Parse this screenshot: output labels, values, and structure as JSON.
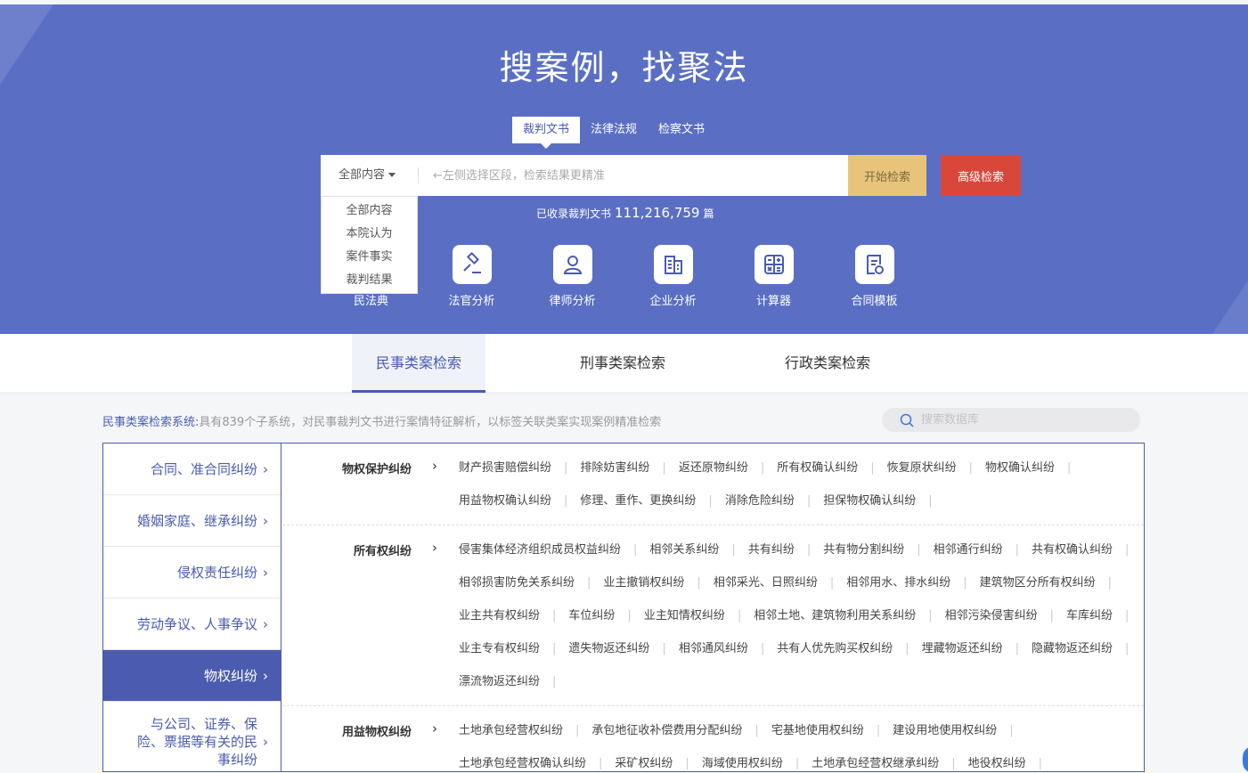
{
  "hero": {
    "title": "搜案例，找聚法",
    "doc_tabs": [
      "裁判文书",
      "法律法规",
      "检察文书"
    ],
    "search": {
      "scope_label": "全部内容",
      "placeholder": "←左侧选择区段，检索结果更精准",
      "start_label": "开始检索",
      "advanced_label": "高级检索"
    },
    "scope_options": [
      "全部内容",
      "本院认为",
      "案件事实",
      "裁判结果"
    ],
    "count_prefix": "已收录裁判文书",
    "count_value": "111,216,759",
    "count_suffix": "篇",
    "tools": [
      {
        "label": "民法典",
        "icon": "book-icon"
      },
      {
        "label": "法官分析",
        "icon": "gavel-icon"
      },
      {
        "label": "律师分析",
        "icon": "person-icon"
      },
      {
        "label": "企业分析",
        "icon": "building-icon"
      },
      {
        "label": "计算器",
        "icon": "calculator-icon"
      },
      {
        "label": "合同模板",
        "icon": "document-icon"
      }
    ]
  },
  "category_tabs": [
    "民事类案检索",
    "刑事类案检索",
    "行政类案检索"
  ],
  "info": {
    "key": "民事类案检索系统:",
    "text": "具有839个子系统，对民事裁判文书进行案情特征解析，以标签关联类案实现案例精准检索"
  },
  "db_search_placeholder": "搜索数据库",
  "sidebar": [
    "合同、准合同纠纷",
    "婚姻家庭、继承纠纷",
    "侵权责任纠纷",
    "劳动争议、人事争议",
    "物权纠纷",
    "与公司、证券、保险、票据等有关的民事纠纷"
  ],
  "groups": [
    {
      "title": "物权保护纠纷",
      "tags": [
        "财产损害赔偿纠纷",
        "排除妨害纠纷",
        "返还原物纠纷",
        "所有权确认纠纷",
        "恢复原状纠纷",
        "物权确认纠纷",
        "用益物权确认纠纷",
        "修理、重作、更换纠纷",
        "消除危险纠纷",
        "担保物权确认纠纷"
      ]
    },
    {
      "title": "所有权纠纷",
      "tags": [
        "侵害集体经济组织成员权益纠纷",
        "相邻关系纠纷",
        "共有纠纷",
        "共有物分割纠纷",
        "相邻通行纠纷",
        "共有权确认纠纷",
        "相邻损害防免关系纠纷",
        "业主撤销权纠纷",
        "相邻采光、日照纠纷",
        "相邻用水、排水纠纷",
        "建筑物区分所有权纠纷",
        "业主共有权纠纷",
        "车位纠纷",
        "业主知情权纠纷",
        "相邻土地、建筑物利用关系纠纷",
        "相邻污染侵害纠纷",
        "车库纠纷",
        "业主专有权纠纷",
        "遗失物返还纠纷",
        "相邻通风纠纷",
        "共有人优先购买权纠纷",
        "埋藏物返还纠纷",
        "隐藏物返还纠纷",
        "漂流物返还纠纷"
      ]
    },
    {
      "title": "用益物权纠纷",
      "tags": [
        "土地承包经营权纠纷",
        "承包地征收补偿费用分配纠纷",
        "宅基地使用权纠纷",
        "建设用地使用权纠纷",
        "土地承包经营权确认纠纷",
        "采矿权纠纷",
        "海域使用权纠纷",
        "土地承包经营权继承纠纷",
        "地役权纠纷"
      ]
    }
  ]
}
